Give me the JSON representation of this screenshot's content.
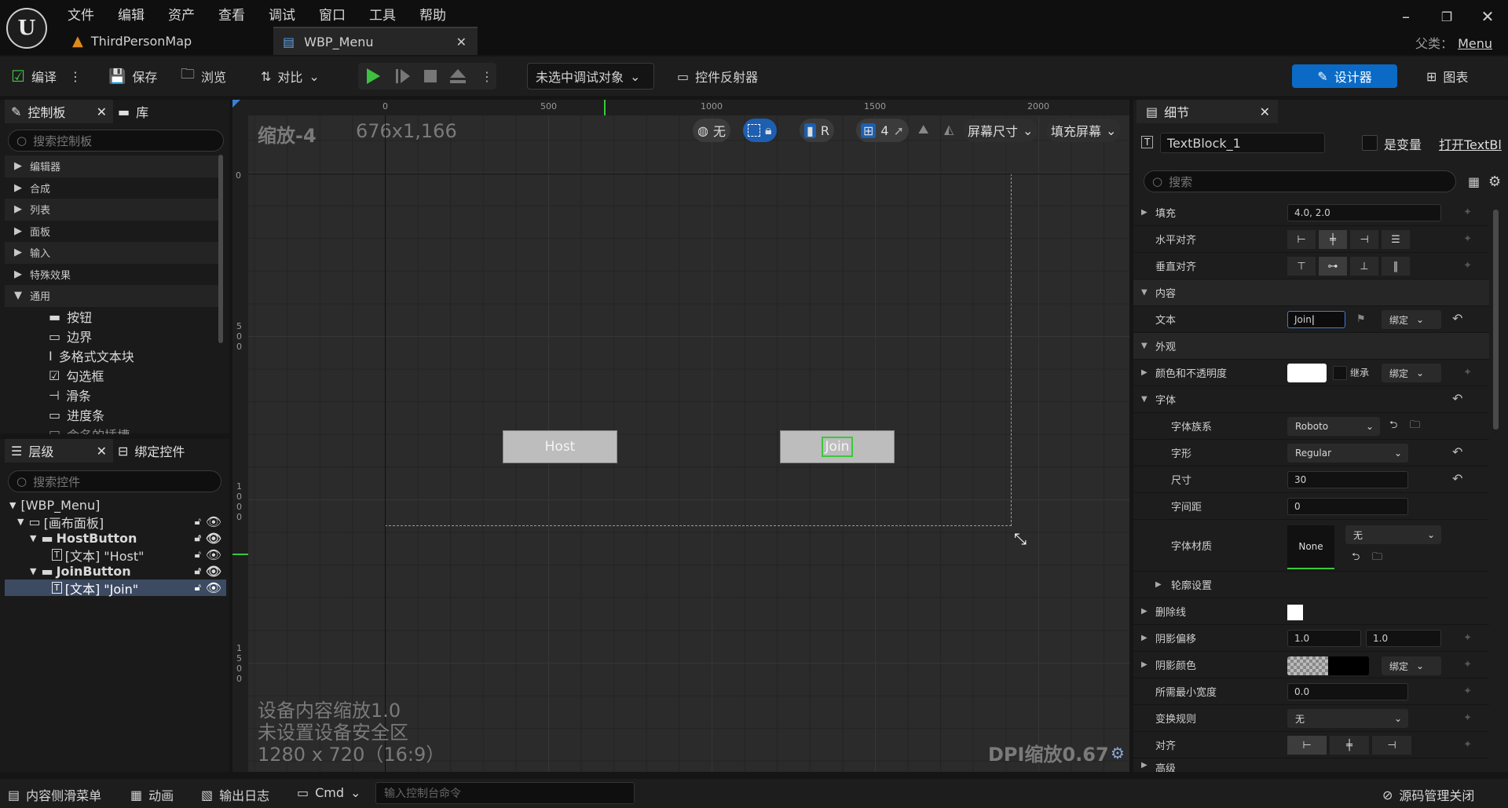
{
  "title_menu": [
    "文件",
    "编辑",
    "资产",
    "查看",
    "调试",
    "窗口",
    "工具",
    "帮助"
  ],
  "tabs": {
    "map": "ThirdPersonMap",
    "widget": "WBP_Menu"
  },
  "parent_class": {
    "label": "父类：",
    "value": "Menu"
  },
  "toolbar": {
    "compile": "编译",
    "save": "保存",
    "browse": "浏览",
    "diff": "对比",
    "debug_object": "未选中调试对象",
    "reflector": "控件反射器",
    "designer": "设计器",
    "graph": "图表"
  },
  "palette": {
    "tab_label": "控制板",
    "library_label": "库",
    "search_placeholder": "搜索控制板",
    "categories": [
      "编辑器",
      "合成",
      "列表",
      "面板",
      "输入",
      "特殊效果",
      "通用"
    ],
    "common_items": [
      "按钮",
      "边界",
      "多格式文本块",
      "勾选框",
      "滑条",
      "进度条",
      "命名的插槽"
    ]
  },
  "hierarchy": {
    "tab_label": "层级",
    "bind_label": "绑定控件",
    "search_placeholder": "搜索控件",
    "rows": [
      "[WBP_Menu]",
      "[画布面板]",
      "HostButton",
      "[文本] \"Host\"",
      "JoinButton",
      "[文本] \"Join\""
    ]
  },
  "canvas": {
    "zoom": "缩放-4",
    "size": "676x1,166",
    "ruler_h": [
      "0",
      "500",
      "1000",
      "1500",
      "2000"
    ],
    "ruler_v": [
      "0",
      "500",
      "1000",
      "1500"
    ],
    "none_label": "无",
    "r_label": "R",
    "grid_snap": "4",
    "screen_size": "屏幕尺寸",
    "fill_screen": "填充屏幕",
    "device_scale": "设备内容缩放1.0",
    "safe_zone": "未设置设备安全区",
    "resolution": "1280 x 720（16:9）",
    "dpi": "DPI缩放0.67",
    "host_text": "Host",
    "join_text": "Join"
  },
  "details": {
    "tab_label": "细节",
    "widget_name": "TextBlock_1",
    "is_variable": "是变量",
    "open_link": "打开TextBl",
    "search_placeholder": "搜索",
    "rows": {
      "padding": "填充",
      "padding_value": "4.0, 2.0",
      "h_align": "水平对齐",
      "v_align": "垂直对齐",
      "content": "内容",
      "text": "文本",
      "text_value": "Join",
      "bind": "绑定",
      "appearance": "外观",
      "color_opacity": "颜色和不透明度",
      "inherit": "继承",
      "font": "字体",
      "font_family": "字体族系",
      "font_family_value": "Roboto",
      "typeface": "字形",
      "typeface_value": "Regular",
      "size": "尺寸",
      "size_value": "30",
      "letter_spacing": "字间距",
      "letter_spacing_value": "0",
      "font_material": "字体材质",
      "font_material_none": "None",
      "font_material_value": "无",
      "outline": "轮廓设置",
      "strikethrough": "删除线",
      "shadow_offset": "阴影偏移",
      "shadow_x": "1.0",
      "shadow_y": "1.0",
      "shadow_color": "阴影颜色",
      "min_width": "所需最小宽度",
      "min_width_value": "0.0",
      "transform_policy": "变换规则",
      "transform_value": "无",
      "justification": "对齐",
      "advanced": "高级"
    }
  },
  "status": {
    "content_drawer": "内容侧滑菜单",
    "animation": "动画",
    "output_log": "输出日志",
    "cmd": "Cmd",
    "console_placeholder": "输入控制台命令",
    "source_control": "源码管理关闭"
  },
  "colors": {
    "accent": "#0a6ac6",
    "selection_green": "#3ac93a",
    "play_green": "#3fbf3f"
  }
}
